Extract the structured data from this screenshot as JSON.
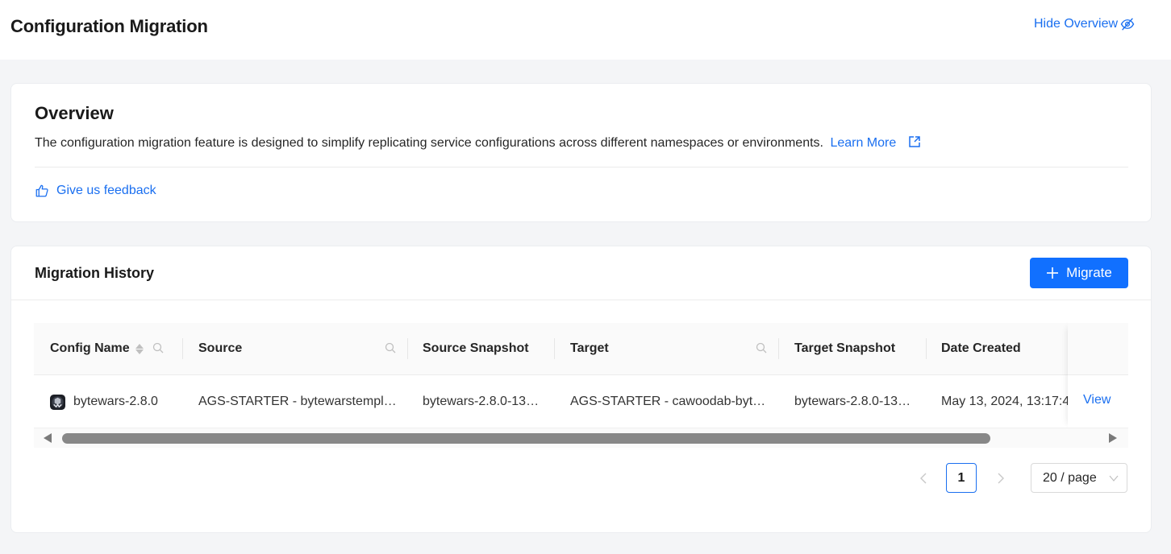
{
  "header": {
    "title": "Configuration Migration",
    "hide_overview_label": "Hide Overview",
    "hide_overview_icon": "eye-slash-icon"
  },
  "overview": {
    "title": "Overview",
    "description": "The configuration migration feature is designed to simplify replicating service configurations across different namespaces or environments.",
    "learn_more_label": "Learn More",
    "learn_more_icon": "external-link-icon",
    "feedback_label": "Give us feedback",
    "feedback_icon": "thumbs-up-icon"
  },
  "history": {
    "title": "Migration History",
    "migrate_label": "Migrate",
    "migrate_icon": "plus-icon",
    "columns": [
      {
        "label": "Config Name",
        "sortable": true,
        "searchable": true
      },
      {
        "label": "Source",
        "sortable": false,
        "searchable": true
      },
      {
        "label": "Source Snapshot",
        "sortable": false,
        "searchable": false
      },
      {
        "label": "Target",
        "sortable": false,
        "searchable": true
      },
      {
        "label": "Target Snapshot",
        "sortable": false,
        "searchable": false
      },
      {
        "label": "Date Created",
        "sortable": false,
        "searchable": false
      }
    ],
    "rows": [
      {
        "config_name": "bytewars-2.8.0",
        "config_icon": "bytewars-app-icon",
        "source": "AGS-STARTER - bytewarstempl…",
        "source_snapshot": "bytewars-2.8.0-13…",
        "target": "AGS-STARTER - cawoodab-byt…",
        "target_snapshot": "bytewars-2.8.0-13…",
        "date_created": "May 13, 2024, 13:17:4",
        "action_label": "View"
      }
    ],
    "scroll_position_fraction": 0.0
  },
  "pagination": {
    "current_page": "1",
    "page_size_label": "20 / page"
  },
  "colors": {
    "accent": "#1170ff",
    "link": "#1a6ff0",
    "background": "#f4f5f7"
  }
}
